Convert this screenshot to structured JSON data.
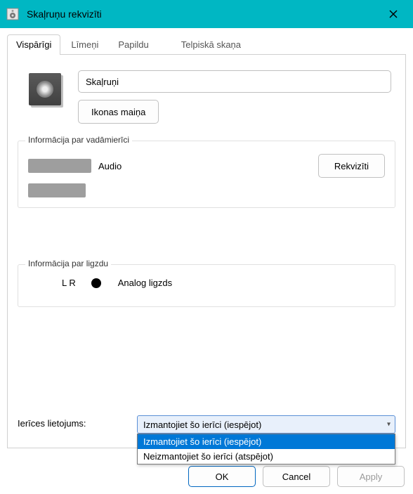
{
  "window": {
    "title": "Skaļruņu rekvizīti"
  },
  "tabs": [
    {
      "label": "Vispārīgi",
      "active": true
    },
    {
      "label": "Līmeņi",
      "active": false
    },
    {
      "label": "Papildu",
      "active": false
    },
    {
      "label": "Telpiskā skaņa",
      "active": false
    }
  ],
  "general": {
    "device_name": "Skaļruņi",
    "change_icon_label": "Ikonas maiņa",
    "controller": {
      "group_title": "Informācija par vadāmierīci",
      "line1_suffix": "Audio",
      "properties_button": "Rekvizīti"
    },
    "jack": {
      "group_title": "Informācija par ligzdu",
      "channels": "L R",
      "name": "Analog ligzds"
    },
    "usage": {
      "label": "Ierīces lietojums:",
      "selected": "Izmantojiet šo ierīci (iespējot)",
      "options": [
        "Izmantojiet šo ierīci (iespējot)",
        "Neizmantojiet šo ierīci (atspējot)"
      ]
    }
  },
  "buttons": {
    "ok": "OK",
    "cancel": "Cancel",
    "apply": "Apply"
  }
}
